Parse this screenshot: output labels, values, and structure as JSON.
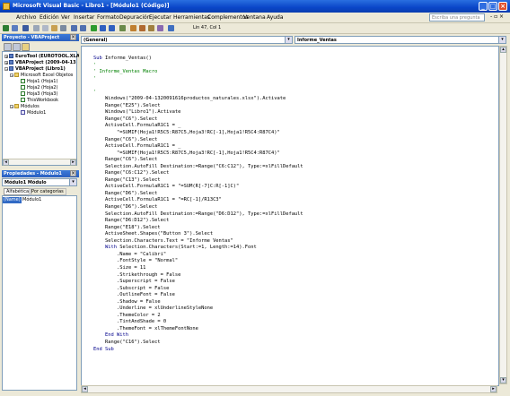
{
  "titlebar": {
    "title": "Microsoft Visual Basic - Libro1 - [Módulo1 (Código)]"
  },
  "menubar": {
    "items": [
      "Archivo",
      "Edición",
      "Ver",
      "Insertar",
      "Formato",
      "Depuración",
      "Ejecutar",
      "Herramientas",
      "Complementos",
      "Ventana",
      "Ayuda"
    ],
    "ask_placeholder": "Escriba una pregunta"
  },
  "toolbar": {
    "position": "Lin 47, Col 1"
  },
  "project_panel": {
    "title": "Proyecto - VBAProject",
    "nodes": [
      "EuroTool (EUROTOOL.XLA)",
      "VBAProject (2009-04-13",
      "VBAProject (Libro1)",
      "Microsoft Excel Objetos",
      "Hoja1 (Hoja1)",
      "Hoja2 (Hoja2)",
      "Hoja3 (Hoja3)",
      "ThisWorkbook",
      "Módulos",
      "Módulo1"
    ]
  },
  "properties_panel": {
    "title": "Propiedades - Módulo1",
    "object": "Módulo1 Módulo",
    "tabs": [
      "Alfabética",
      "Por categorías"
    ],
    "row_name": "(Name)",
    "row_value": "Módulo1"
  },
  "code_window": {
    "object_combo": "(General)",
    "proc_combo": "Informe_Ventas",
    "lines": [
      "Sub Informe_Ventas()",
      "'",
      "' Informe_Ventas Macro",
      "'",
      "",
      "'",
      "    Windows(\"2009-04-1320091616productos_naturales.xlsx\").Activate",
      "    Range(\"E25\").Select",
      "    Windows(\"Libro1\").Activate",
      "    Range(\"C6\").Select",
      "    ActiveCell.FormulaR1C1 = _",
      "        \"=SUMIF(Hoja1!R5C5:R87C5,Hoja3!RC[-1],Hoja1!R5C4:R87C4)\"",
      "    Range(\"C6\").Select",
      "    ActiveCell.FormulaR1C1 = _",
      "        \"=SUMIF(Hoja1!R5C5:R87C5,Hoja3!RC[-1],Hoja1!R5C4:R87C4)\"",
      "    Range(\"C6\").Select",
      "    Selection.AutoFill Destination:=Range(\"C6:C12\"), Type:=xlFillDefault",
      "    Range(\"C6:C12\").Select",
      "    Range(\"C13\").Select",
      "    ActiveCell.FormulaR1C1 = \"=SUM(R[-7]C:R[-1]C)\"",
      "    Range(\"D6\").Select",
      "    ActiveCell.FormulaR1C1 = \"=RC[-1]/R13C3\"",
      "    Range(\"D6\").Select",
      "    Selection.AutoFill Destination:=Range(\"D6:D12\"), Type:=xlFillDefault",
      "    Range(\"D6:D12\").Select",
      "    Range(\"E18\").Select",
      "    ActiveSheet.Shapes(\"Button 3\").Select",
      "    Selection.Characters.Text = \"Informe Ventas\"",
      "    With Selection.Characters(Start:=1, Length:=14).Font",
      "        .Name = \"Calibri\"",
      "        .FontStyle = \"Normal\"",
      "        .Size = 11",
      "        .Strikethrough = False",
      "        .Superscript = False",
      "        .Subscript = False",
      "        .OutlineFont = False",
      "        .Shadow = False",
      "        .Underline = xlUnderlineStyleNone",
      "        .ThemeColor = 2",
      "        .TintAndShade = 0",
      "        .ThemeFont = xlThemeFontNone",
      "    End With",
      "    Range(\"C16\").Select",
      "End Sub"
    ]
  },
  "colors": {
    "title_bar": "#0a46c8",
    "keyword": "#00008b",
    "comment": "#008000"
  }
}
